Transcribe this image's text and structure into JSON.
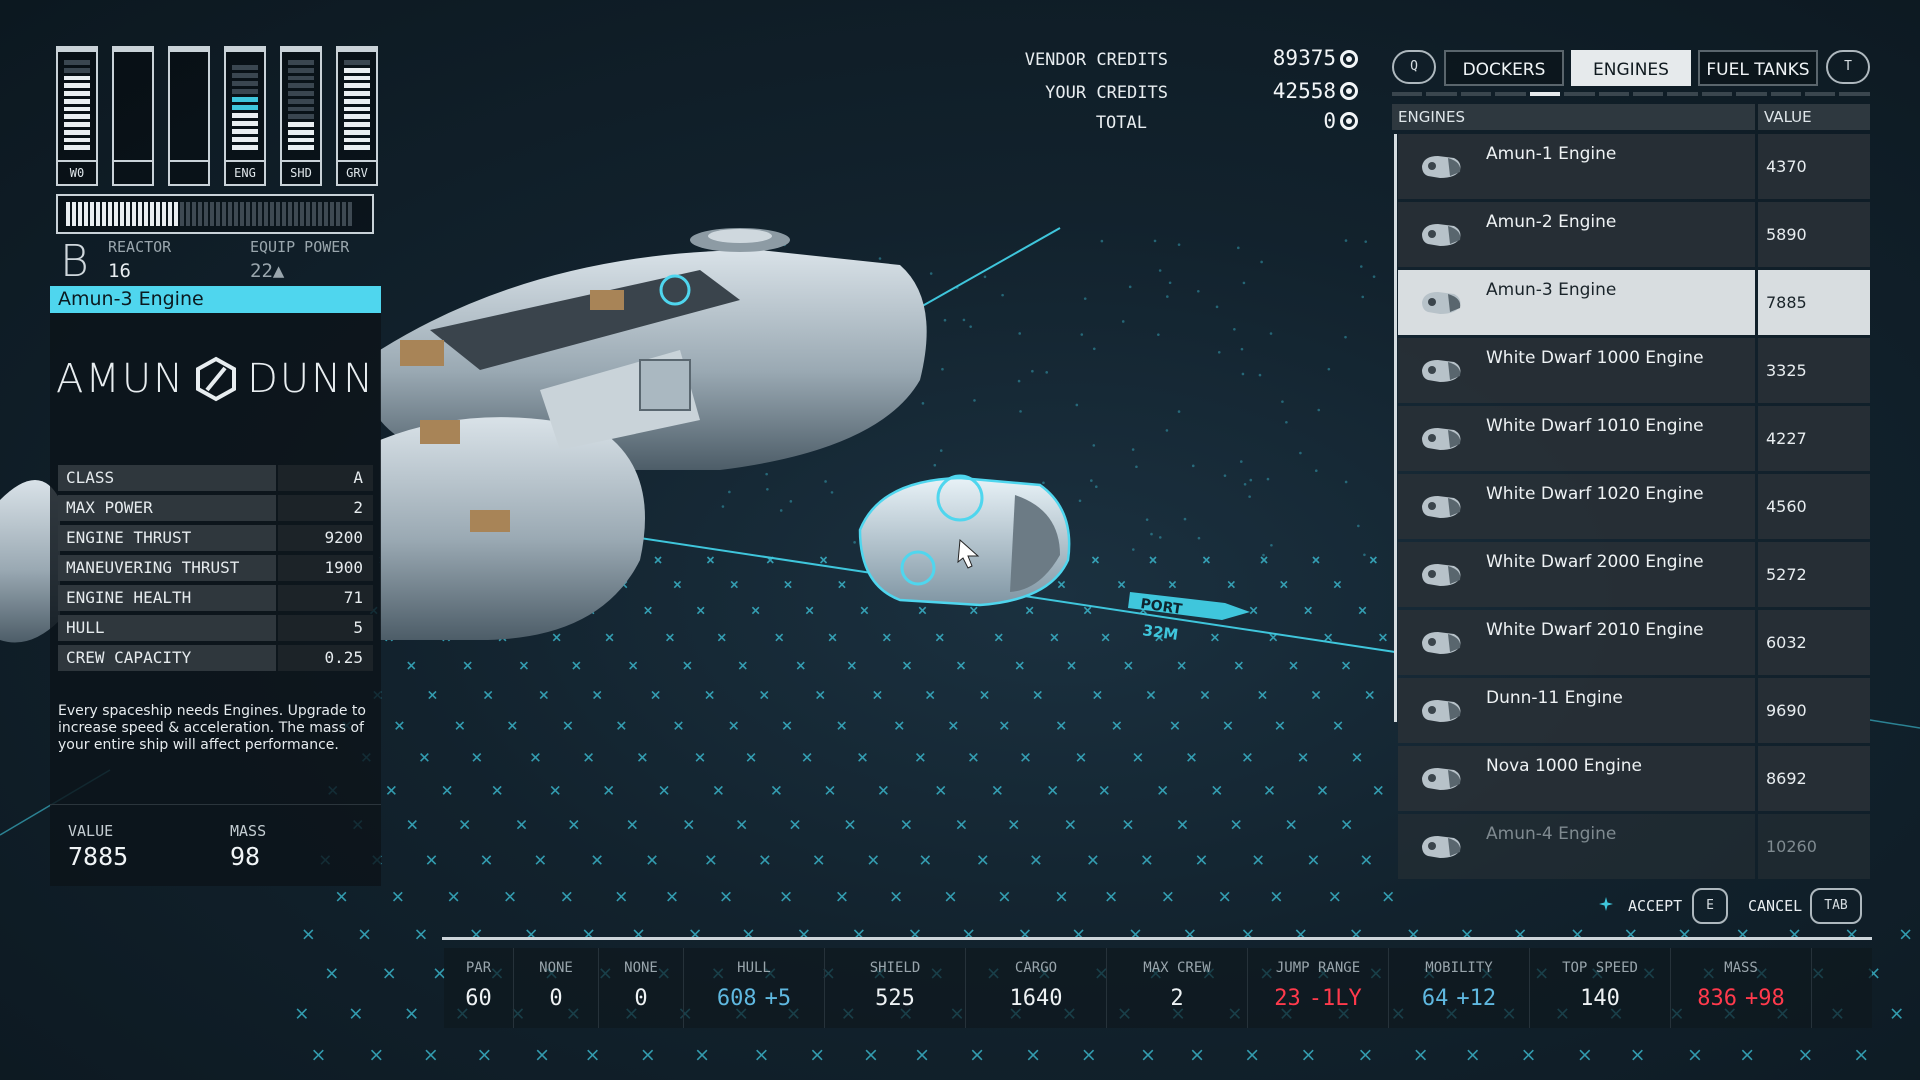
{
  "power": {
    "slots": [
      {
        "label": "W0",
        "filled": 10,
        "cyan": 0,
        "total": 12
      },
      {
        "label": "",
        "filled": 0,
        "cyan": 0,
        "total": 0
      },
      {
        "label": "",
        "filled": 0,
        "cyan": 0,
        "total": 0
      },
      {
        "label": "ENG",
        "filled": 5,
        "cyan": 2,
        "total": 11
      },
      {
        "label": "SHD",
        "filled": 4,
        "cyan": 0,
        "total": 12
      },
      {
        "label": "GRV",
        "filled": 11,
        "cyan": 0,
        "total": 12
      }
    ],
    "reactor_fill": 0.4,
    "reactor_class": "B",
    "reactor_label": "REACTOR",
    "reactor_value": "16",
    "equip_label": "EQUIP POWER",
    "equip_value": "22▲"
  },
  "item": {
    "title": "Amun-3 Engine",
    "brand_left": "AMUN",
    "brand_right": "DUNN",
    "stats": [
      {
        "key": "CLASS",
        "value": "A"
      },
      {
        "key": "MAX POWER",
        "value": "2"
      },
      {
        "key": "ENGINE THRUST",
        "value": "9200"
      },
      {
        "key": "MANEUVERING THRUST",
        "value": "1900"
      },
      {
        "key": "ENGINE HEALTH",
        "value": "71"
      },
      {
        "key": "HULL",
        "value": "5"
      },
      {
        "key": "CREW CAPACITY",
        "value": "0.25"
      }
    ],
    "description": "Every spaceship needs Engines. Upgrade to increase speed & acceleration. The mass of your entire ship will affect performance.",
    "value_label": "VALUE",
    "value": "7885",
    "mass_label": "MASS",
    "mass": "98"
  },
  "credits": {
    "vendor_label": "VENDOR CREDITS",
    "vendor_value": "89375",
    "yours_label": "YOUR CREDITS",
    "yours_value": "42558",
    "total_label": "TOTAL",
    "total_value": "0"
  },
  "tabs": {
    "prev_key": "Q",
    "next_key": "T",
    "items": [
      "DOCKERS",
      "ENGINES",
      "FUEL TANKS"
    ],
    "active": "ENGINES",
    "dot_count": 14,
    "dot_active": 4
  },
  "list": {
    "col_name": "ENGINES",
    "col_value": "VALUE",
    "rows": [
      {
        "name": "Amun-1 Engine",
        "value": "4370",
        "state": "normal",
        "thumb": "engine-thumbnail-icon"
      },
      {
        "name": "Amun-2 Engine",
        "value": "5890",
        "state": "normal",
        "thumb": "engine-thumbnail-icon"
      },
      {
        "name": "Amun-3 Engine",
        "value": "7885",
        "state": "selected",
        "thumb": "engine-thumbnail-icon"
      },
      {
        "name": "White Dwarf 1000 Engine",
        "value": "3325",
        "state": "normal",
        "thumb": "engine-thumbnail-icon"
      },
      {
        "name": "White Dwarf 1010 Engine",
        "value": "4227",
        "state": "normal",
        "thumb": "engine-thumbnail-icon"
      },
      {
        "name": "White Dwarf 1020 Engine",
        "value": "4560",
        "state": "normal",
        "thumb": "engine-thumbnail-icon"
      },
      {
        "name": "White Dwarf 2000 Engine",
        "value": "5272",
        "state": "normal",
        "thumb": "engine-thumbnail-icon"
      },
      {
        "name": "White Dwarf 2010 Engine",
        "value": "6032",
        "state": "normal",
        "thumb": "engine-thumbnail-icon"
      },
      {
        "name": "Dunn-11 Engine",
        "value": "9690",
        "state": "normal",
        "thumb": "engine-thumbnail-icon"
      },
      {
        "name": "Nova 1000 Engine",
        "value": "8692",
        "state": "normal",
        "thumb": "engine-thumbnail-icon"
      },
      {
        "name": "Amun-4 Engine",
        "value": "10260",
        "state": "dim",
        "thumb": "engine-thumbnail-icon"
      }
    ]
  },
  "actions": {
    "accept_label": "ACCEPT",
    "accept_key": "E",
    "cancel_label": "CANCEL",
    "cancel_key": "TAB"
  },
  "scene": {
    "port_label": "PORT",
    "distance_label": "32M"
  },
  "ship_stats": [
    {
      "label": "PAR",
      "value": "60",
      "delta": "",
      "tone": "normal"
    },
    {
      "label": "NONE",
      "value": "0",
      "delta": "",
      "tone": "normal"
    },
    {
      "label": "NONE",
      "value": "0",
      "delta": "",
      "tone": "normal"
    },
    {
      "label": "HULL",
      "value": "608",
      "delta": "+5",
      "tone": "pos"
    },
    {
      "label": "SHIELD",
      "value": "525",
      "delta": "",
      "tone": "normal"
    },
    {
      "label": "CARGO",
      "value": "1640",
      "delta": "",
      "tone": "normal"
    },
    {
      "label": "MAX CREW",
      "value": "2",
      "delta": "",
      "tone": "normal"
    },
    {
      "label": "JUMP RANGE",
      "value": "23",
      "delta": "-1LY",
      "tone": "neg"
    },
    {
      "label": "MOBILITY",
      "value": "64",
      "delta": "+12",
      "tone": "pos"
    },
    {
      "label": "TOP SPEED",
      "value": "140",
      "delta": "",
      "tone": "normal"
    },
    {
      "label": "MASS",
      "value": "836",
      "delta": "+98",
      "tone": "neg"
    }
  ],
  "colors": {
    "accent": "#4fd6ee",
    "negative": "#ff3a4c",
    "positive": "#5fb8e0"
  }
}
